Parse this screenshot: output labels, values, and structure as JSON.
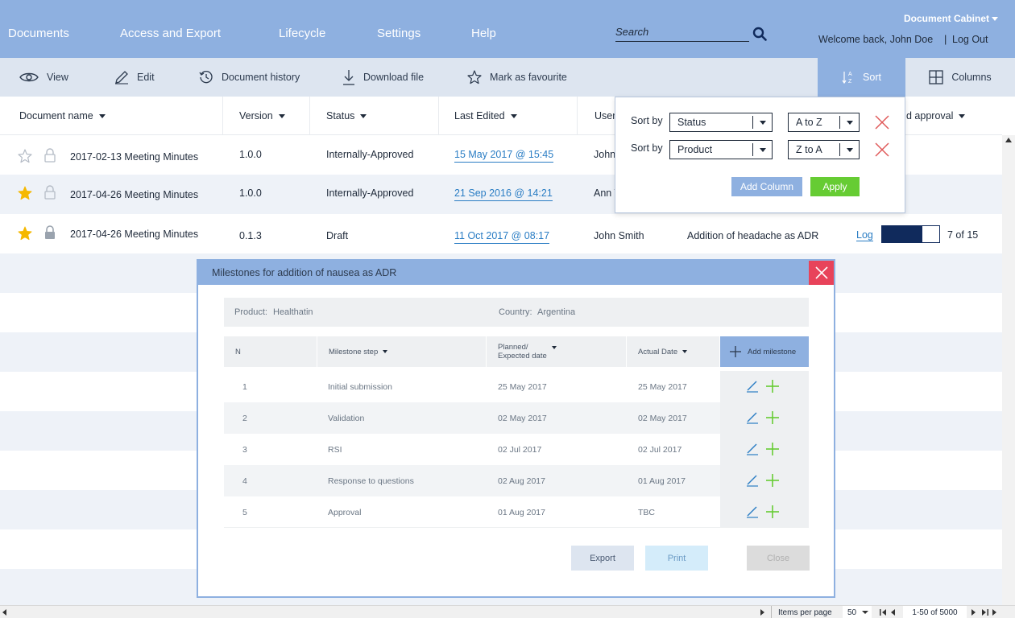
{
  "nav": {
    "items": [
      "Documents",
      "Access and Export",
      "Lifecycle",
      "Settings",
      "Help"
    ],
    "search_placeholder": "Search",
    "cabinet_label": "Document Cabinet",
    "welcome": "Welcome back, John Doe",
    "separator": "|",
    "logout": "Log Out"
  },
  "toolbar": {
    "view": "View",
    "edit": "Edit",
    "history": "Document history",
    "download": "Download file",
    "favourite": "Mark as favourite",
    "sort": "Sort",
    "columns": "Columns"
  },
  "table": {
    "headers": {
      "name": "Document name",
      "version": "Version",
      "status": "Status",
      "edited": "Last Edited",
      "user": "User",
      "approval": "d approval"
    },
    "rows": [
      {
        "favourite": false,
        "locked": false,
        "name": "2017-02-13 Meeting Minutes",
        "version": "1.0.0",
        "status": "Internally-Approved",
        "edited": "15 May 2017 @ 15:45",
        "user": "John"
      },
      {
        "favourite": true,
        "locked": false,
        "name": "2017-04-26 Meeting Minutes",
        "version": "1.0.0",
        "status": "Internally-Approved",
        "edited": "21 Sep 2016 @ 14:21",
        "user": "Ann T"
      },
      {
        "favourite": true,
        "locked": true,
        "name": "2017-04-26 Meeting Minutes",
        "version": "0.1.3",
        "status": "Draft",
        "edited": "11 Oct 2017 @ 08:17",
        "user": "John Smith",
        "description": "Addition of headache as ADR",
        "log": "Log",
        "progress": 0.7,
        "progress_text": "7 of 15"
      }
    ]
  },
  "sort_popup": {
    "label1": "Sort by",
    "field1": "Status",
    "order1": "A to Z",
    "label2": "Sort by",
    "field2": "Product",
    "order2": "Z to A",
    "add_column": "Add Column",
    "apply": "Apply",
    "colors": {
      "apply": "#66cc33",
      "remove": "#e05a5a"
    }
  },
  "modal": {
    "title": "Milestones for addition of nausea as ADR",
    "product_label": "Product:",
    "product_value": "Healthatin",
    "country_label": "Country:",
    "country_value": "Argentina",
    "headers": {
      "n": "N",
      "step": "Milestone step",
      "planned_line1": "Planned/",
      "planned_line2": "Expected date",
      "actual": "Actual Date",
      "add": "Add milestone"
    },
    "rows": [
      {
        "n": "1",
        "step": "Initial submission",
        "planned": "25 May 2017",
        "actual": "25 May 2017"
      },
      {
        "n": "2",
        "step": "Validation",
        "planned": "02 May 2017",
        "actual": "02 May 2017"
      },
      {
        "n": "3",
        "step": "RSI",
        "planned": "02 Jul 2017",
        "actual": "02 Jul 2017"
      },
      {
        "n": "4",
        "step": "Response to questions",
        "planned": "02 Aug 2017",
        "actual": "01 Aug 2017"
      },
      {
        "n": "5",
        "step": "Approval",
        "planned": "01 Aug 2017",
        "actual": "TBC"
      }
    ],
    "export": "Export",
    "print": "Print",
    "close": "Close"
  },
  "pager": {
    "items_label": "Items per page",
    "per_page": "50",
    "range": "1-50 of 5000"
  },
  "colors": {
    "header_blue": "#8eb0e0",
    "toolbar_bg": "#dde5f0",
    "link_blue": "#2a7dc4",
    "close_red": "#e8435a",
    "star_yellow": "#f5b800",
    "progress_navy": "#102a5c"
  }
}
